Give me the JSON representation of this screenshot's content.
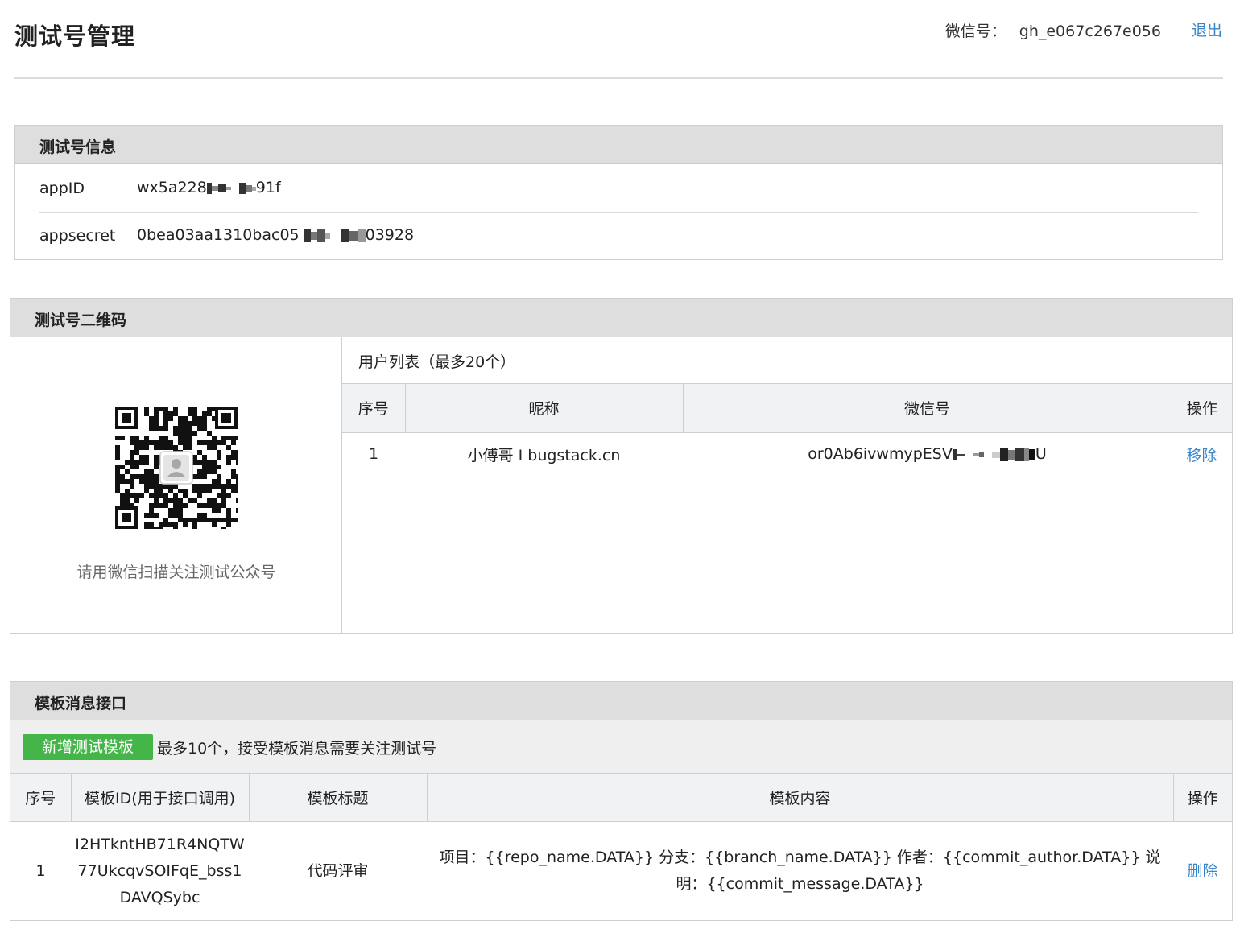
{
  "header": {
    "title": "测试号管理",
    "account_label": "微信号：",
    "account_value": "gh_e067c267e056",
    "logout_label": "退出"
  },
  "test_info": {
    "title": "测试号信息",
    "appid_label": "appID",
    "appid_prefix": "wx5a228",
    "appid_suffix": "91f",
    "appsecret_label": "appsecret",
    "appsecret_prefix": "0bea03aa1310bac05",
    "appsecret_suffix": "03928"
  },
  "qr_panel": {
    "title": "测试号二维码",
    "caption": "请用微信扫描关注测试公众号",
    "user_list_title": "用户列表（最多20个）",
    "columns": [
      "序号",
      "昵称",
      "微信号",
      "操作"
    ],
    "rows": [
      {
        "index": "1",
        "nickname": "小傅哥 I bugstack.cn",
        "wechat_prefix": "or0Ab6ivwmypESV",
        "wechat_suffix": "U",
        "action": "移除"
      }
    ]
  },
  "template_panel": {
    "title": "模板消息接口",
    "add_button": "新增测试模板",
    "note": "最多10个，接受模板消息需要关注测试号",
    "columns": [
      "序号",
      "模板ID(用于接口调用)",
      "模板标题",
      "模板内容",
      "操作"
    ],
    "rows": [
      {
        "index": "1",
        "template_id": "I2HTkntHB71R4NQTW77UkcqvSOIFqE_bss1DAVQSybc",
        "template_title": "代码评审",
        "template_content": "项目：{{repo_name.DATA}} 分支：{{branch_name.DATA}} 作者：{{commit_author.DATA}} 说明：{{commit_message.DATA}}",
        "action": "删除"
      }
    ]
  },
  "colors": {
    "link": "#3a86c9",
    "primary_button": "#44b549",
    "panel_header": "#dedede"
  }
}
